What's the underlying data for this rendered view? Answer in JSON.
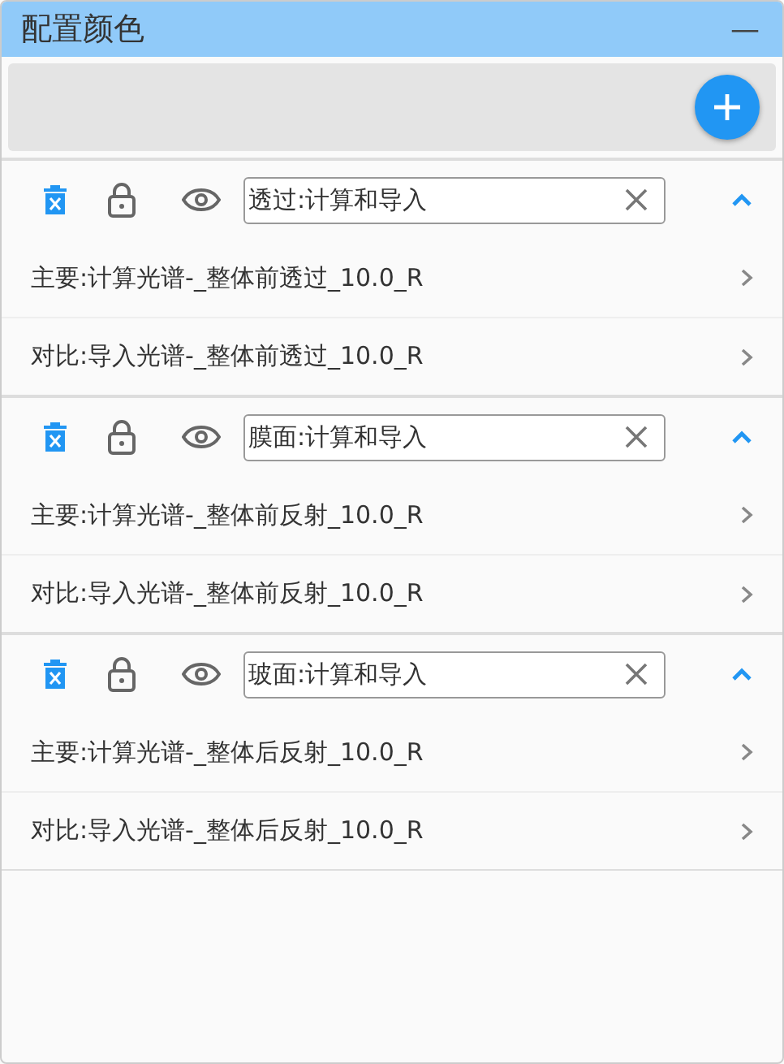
{
  "window": {
    "title": "配置颜色",
    "collapse_symbol": "—"
  },
  "groups": [
    {
      "name": "透过:计算和导入",
      "expanded": true,
      "items": [
        "主要:计算光谱-_整体前透过_10.0_R",
        "对比:导入光谱-_整体前透过_10.0_R"
      ]
    },
    {
      "name": "膜面:计算和导入",
      "expanded": true,
      "items": [
        "主要:计算光谱-_整体前反射_10.0_R",
        "对比:导入光谱-_整体前反射_10.0_R"
      ]
    },
    {
      "name": "玻面:计算和导入",
      "expanded": true,
      "items": [
        "主要:计算光谱-_整体后反射_10.0_R",
        "对比:导入光谱-_整体后反射_10.0_R"
      ]
    }
  ]
}
